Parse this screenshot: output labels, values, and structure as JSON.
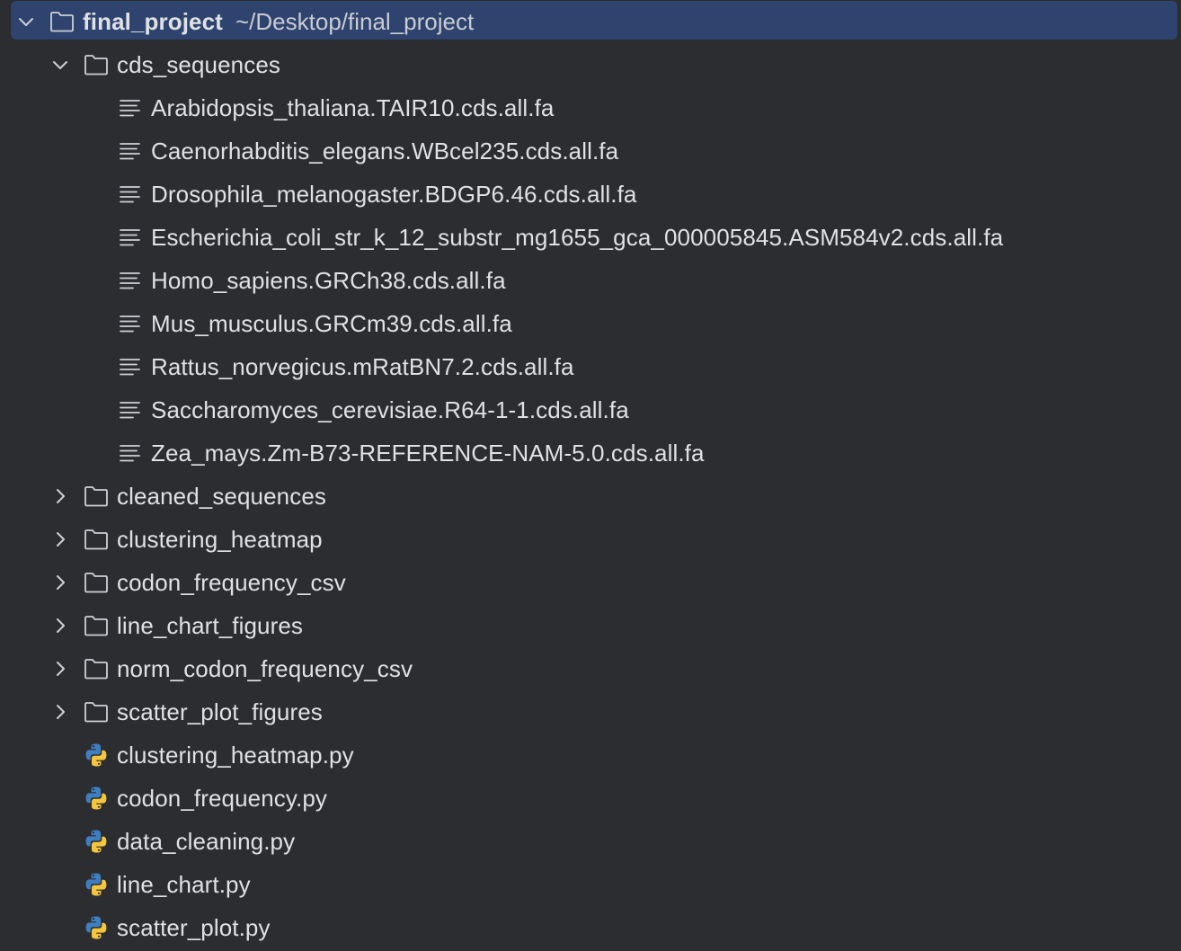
{
  "root": {
    "name": "final_project",
    "path": "~/Desktop/final_project"
  },
  "cds_folder": {
    "name": "cds_sequences",
    "files": [
      "Arabidopsis_thaliana.TAIR10.cds.all.fa",
      "Caenorhabditis_elegans.WBcel235.cds.all.fa",
      "Drosophila_melanogaster.BDGP6.46.cds.all.fa",
      "Escherichia_coli_str_k_12_substr_mg1655_gca_000005845.ASM584v2.cds.all.fa",
      "Homo_sapiens.GRCh38.cds.all.fa",
      "Mus_musculus.GRCm39.cds.all.fa",
      "Rattus_norvegicus.mRatBN7.2.cds.all.fa",
      "Saccharomyces_cerevisiae.R64-1-1.cds.all.fa",
      "Zea_mays.Zm-B73-REFERENCE-NAM-5.0.cds.all.fa"
    ]
  },
  "collapsed_folders": [
    "cleaned_sequences",
    "clustering_heatmap",
    "codon_frequency_csv",
    "line_chart_figures",
    "norm_codon_frequency_csv",
    "scatter_plot_figures"
  ],
  "python_files": [
    "clustering_heatmap.py",
    "codon_frequency.py",
    "data_cleaning.py",
    "line_chart.py",
    "scatter_plot.py"
  ],
  "colors": {
    "background": "#2b2d30",
    "selection": "#2e436e",
    "text": "#dfe1e5",
    "icon_gray": "#ced0d6",
    "python_blue": "#3f7fc1",
    "python_yellow": "#f5c63c"
  },
  "icons": {
    "folder": "folder-icon",
    "text_file": "text-file-icon",
    "python_file": "python-file-icon",
    "expanded": "chevron-down-icon",
    "collapsed": "chevron-right-icon"
  }
}
